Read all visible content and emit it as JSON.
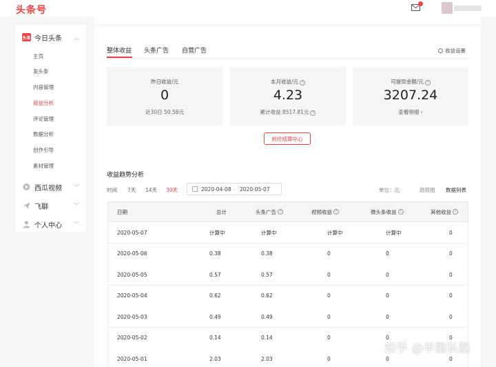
{
  "header": {
    "logo": "头条号",
    "mail_icon": "mail-icon",
    "colors": {
      "brand": "#f04142"
    }
  },
  "sidebar": {
    "groups": [
      {
        "label": "今日头条",
        "badge": "头条",
        "icon": "toutiao-icon",
        "expanded": true
      },
      {
        "label": "西瓜视频",
        "icon": "xigua-icon",
        "expanded": false
      },
      {
        "label": "飞聊",
        "icon": "feiliao-icon",
        "expanded": false
      },
      {
        "label": "个人中心",
        "icon": "person-icon",
        "expanded": false
      }
    ],
    "items": [
      "主页",
      "发头条",
      "内容管理",
      "收益分析",
      "评论管理",
      "数据分析",
      "创作引导",
      "素材管理"
    ],
    "active_item": "收益分析"
  },
  "tabs": [
    "整体收益",
    "头条广告",
    "自营广告"
  ],
  "settings_label": "收益设置",
  "stats": [
    {
      "label": "昨日收益/元",
      "value": "0",
      "sub": "近30日 50.58元"
    },
    {
      "label": "本月收益/元",
      "value": "4.23",
      "sub": "累计收益 8517.81元"
    },
    {
      "label": "可提现金额/元",
      "value": "3207.24",
      "sub": "查看明细 ›"
    }
  ],
  "settle_button": "前往结算中心",
  "trend": {
    "title": "收益趋势分析",
    "time_label": "时间",
    "ranges": [
      "7天",
      "14天",
      "30天"
    ],
    "active_range": "30天",
    "date_from": "2020-04-08",
    "date_to": "2020-05-07",
    "unit": "单位：元",
    "trend_label": "趋势图",
    "list_label": "数据列表"
  },
  "table": {
    "headers": [
      "日期",
      "总计",
      "头条广告",
      "视频收益",
      "微头条收益",
      "其他收益"
    ],
    "rows": [
      [
        "2020-05-07",
        "计算中",
        "计算中",
        "计算中",
        "计算中",
        "0"
      ],
      [
        "2020-05-06",
        "0.38",
        "0.38",
        "0",
        "0",
        "0"
      ],
      [
        "2020-05-05",
        "0.57",
        "0.57",
        "0",
        "0",
        "0"
      ],
      [
        "2020-05-04",
        "0.62",
        "0.62",
        "0",
        "0",
        "0"
      ],
      [
        "2020-05-03",
        "0.49",
        "0.49",
        "0",
        "0",
        "0"
      ],
      [
        "2020-05-02",
        "0.14",
        "0.14",
        "0",
        "0",
        "0"
      ],
      [
        "2020-05-01",
        "2.03",
        "2.03",
        "0",
        "0",
        "0"
      ]
    ]
  },
  "watermark": "知乎 @半撇私塾"
}
